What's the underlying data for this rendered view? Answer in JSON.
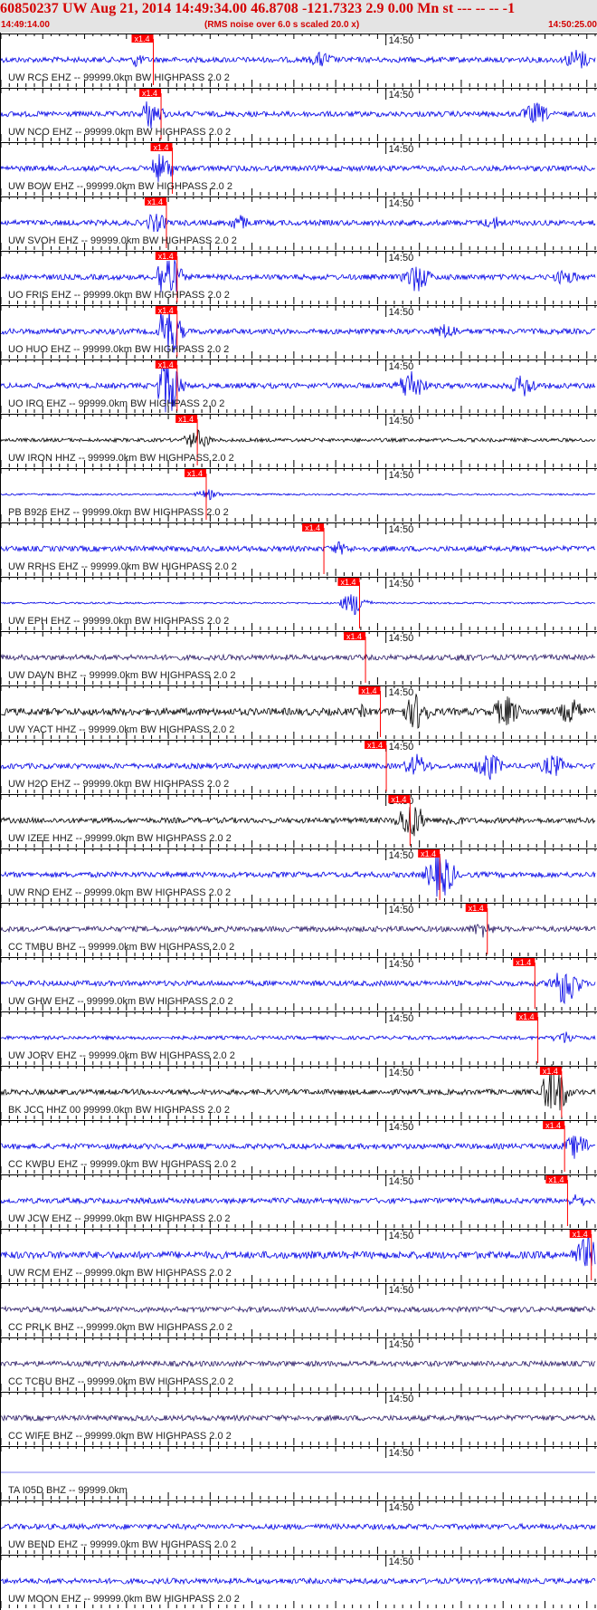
{
  "header": {
    "title": "60850237 UW Aug 21, 2014 14:49:34.00   46.8708 -121.7323  2.9 0.00 Mn st --- -- --  -1",
    "start_time": "14:49:14.00",
    "note": "(RMS noise over 6.0 s scaled 20.0 x)",
    "end_time": "14:50:25.00"
  },
  "time_tick_label": "14:50",
  "pick_label": "x1.4",
  "colors": {
    "header_bg": "#e4e4e4",
    "header_text": "#d40000",
    "blue": "#0000e6",
    "black": "#000000",
    "purple": "#2a1a66",
    "pick": "#ff0000",
    "axis": "#000000"
  },
  "stations": [
    {
      "label": "UW RCS EHZ -- 99999.0km BW  HIGHPASS  2.0  2",
      "color": "blue",
      "pick": 0.223,
      "amp": 3,
      "env": [
        [
          0.09,
          14
        ],
        [
          0.21,
          22
        ],
        [
          0.54,
          10
        ],
        [
          0.97,
          14
        ]
      ]
    },
    {
      "label": "UW NCO EHZ -- 99999.0km BW  HIGHPASS  2.0  2",
      "color": "blue",
      "pick": 0.236,
      "amp": 3,
      "env": [
        [
          0.25,
          18
        ],
        [
          0.9,
          14
        ]
      ]
    },
    {
      "label": "UW BOW EHZ -- 99999.0km BW  HIGHPASS  2.0  2",
      "color": "blue",
      "pick": 0.255,
      "amp": 3,
      "env": [
        [
          0.25,
          25
        ],
        [
          0.27,
          18
        ]
      ]
    },
    {
      "label": "UW SVOH EHZ -- 99999.0km BW  HIGHPASS  2.0  2",
      "color": "blue",
      "pick": 0.245,
      "amp": 3,
      "env": [
        [
          0.26,
          12
        ],
        [
          0.4,
          10
        ],
        [
          0.83,
          8
        ]
      ]
    },
    {
      "label": "UO FRIS EHZ -- 99999.0km BW  HIGHPASS  2.0  2",
      "color": "blue",
      "pick": 0.263,
      "amp": 3,
      "env": [
        [
          0.28,
          30
        ],
        [
          0.7,
          18
        ],
        [
          0.95,
          10
        ]
      ]
    },
    {
      "label": "UO HUO EHZ -- 99999.0km BW  HIGHPASS  2.0  2",
      "color": "blue",
      "pick": 0.263,
      "amp": 3,
      "env": [
        [
          0.28,
          34
        ],
        [
          0.75,
          10
        ]
      ]
    },
    {
      "label": "UO IRO EHZ -- 99999.0km BW  HIGHPASS  2.0  2",
      "color": "blue",
      "pick": 0.263,
      "amp": 3,
      "env": [
        [
          0.28,
          36
        ],
        [
          0.69,
          20
        ],
        [
          0.88,
          14
        ]
      ]
    },
    {
      "label": "UW IRON HHZ -- 99999.0km BW  HIGHPASS  2.0  2",
      "color": "black",
      "pick": 0.297,
      "amp": 2,
      "env": [
        [
          0.33,
          12
        ]
      ]
    },
    {
      "label": "PB B926 EHZ -- 99999.0km BW  HIGHPASS  2.0  2",
      "color": "blue",
      "pick": 0.312,
      "amp": 1,
      "env": [
        [
          0.02,
          14
        ],
        [
          0.35,
          6
        ]
      ]
    },
    {
      "label": "UW RRHS EHZ -- 99999.0km BW  HIGHPASS  2.0  2",
      "color": "blue",
      "pick": 0.51,
      "amp": 3,
      "env": [
        [
          0.15,
          12
        ],
        [
          0.57,
          8
        ]
      ]
    },
    {
      "label": "UW EPH EHZ -- 99999.0km BW  HIGHPASS  2.0  2",
      "color": "blue",
      "pick": 0.57,
      "amp": 1,
      "env": [
        [
          0.03,
          16
        ],
        [
          0.595,
          14
        ]
      ]
    },
    {
      "label": "UW DAVN BHZ -- 99999.0km BW  HIGHPASS  2.0  2",
      "color": "purple",
      "pick": 0.58,
      "amp": 3,
      "env": [
        [
          0.78,
          6
        ]
      ]
    },
    {
      "label": "UW YACT HHZ -- 99999.0km BW  HIGHPASS  2.0  2",
      "color": "black",
      "pick": 0.605,
      "amp": 4,
      "env": [
        [
          0.59,
          16
        ],
        [
          0.7,
          22
        ],
        [
          0.85,
          20
        ],
        [
          0.96,
          16
        ]
      ]
    },
    {
      "label": "UW H2O EHZ -- 99999.0km BW  HIGHPASS  2.0  2",
      "color": "blue",
      "pick": 0.615,
      "amp": 3,
      "env": [
        [
          0.7,
          14
        ],
        [
          0.82,
          18
        ],
        [
          0.93,
          14
        ]
      ]
    },
    {
      "label": "UW IZEE HHZ -- 99999.0km BW  HIGHPASS  2.0  2",
      "color": "black",
      "pick": 0.655,
      "amp": 3,
      "env": [
        [
          0.69,
          24
        ],
        [
          0.76,
          8
        ]
      ]
    },
    {
      "label": "UW RNO EHZ -- 99999.0km BW  HIGHPASS  2.0  2",
      "color": "blue",
      "pick": 0.705,
      "amp": 3,
      "env": [
        [
          0.74,
          30
        ]
      ]
    },
    {
      "label": "CC TMBU BHZ -- 99999.0km BW  HIGHPASS  2.0  2",
      "color": "purple",
      "pick": 0.785,
      "amp": 3,
      "env": [
        [
          0.81,
          10
        ]
      ]
    },
    {
      "label": "UW GHW EHZ -- 99999.0km BW  HIGHPASS  2.0  2",
      "color": "blue",
      "pick": 0.865,
      "amp": 3,
      "env": [
        [
          0.95,
          28
        ]
      ]
    },
    {
      "label": "UW JORV EHZ -- 99999.0km BW  HIGHPASS  2.0  2",
      "color": "blue",
      "pick": 0.87,
      "amp": 2,
      "env": [
        [
          0.95,
          8
        ]
      ]
    },
    {
      "label": "BK JCC HHZ 00 99999.0km BW  HIGHPASS  2.0  2",
      "color": "black",
      "pick": 0.91,
      "amp": 3,
      "env": [
        [
          0.69,
          20
        ],
        [
          0.82,
          16
        ],
        [
          0.93,
          34
        ]
      ]
    },
    {
      "label": "CC KWBU EHZ -- 99999.0km BW  HIGHPASS  2.0  2",
      "color": "blue",
      "pick": 0.915,
      "amp": 3,
      "env": [
        [
          0.97,
          16
        ]
      ]
    },
    {
      "label": "UW JCW EHZ -- 99999.0km BW  HIGHPASS  2.0  2",
      "color": "blue",
      "pick": 0.92,
      "amp": 3,
      "env": [
        [
          0.97,
          8
        ]
      ]
    },
    {
      "label": "UW RCM EHZ -- 99999.0km BW  HIGHPASS  2.0  2",
      "color": "blue",
      "pick": 0.96,
      "amp": 4,
      "env": [
        [
          0.985,
          22
        ]
      ]
    },
    {
      "label": "CC PRLK BHZ -- 99999.0km BW  HIGHPASS  2.0  2",
      "color": "purple",
      "pick": null,
      "amp": 3,
      "env": []
    },
    {
      "label": "CC TCBU BHZ -- 99999.0km BW  HIGHPASS  2.0  2",
      "color": "purple",
      "pick": null,
      "amp": 3,
      "env": []
    },
    {
      "label": "CC WIFE BHZ -- 99999.0km BW  HIGHPASS  2.0  2",
      "color": "purple",
      "pick": null,
      "amp": 3,
      "env": []
    },
    {
      "label": "TA I05D BHZ -- 99999.0km",
      "color": "blue",
      "pick": null,
      "amp": 0,
      "env": []
    },
    {
      "label": "UW BEND EHZ -- 99999.0km BW  HIGHPASS  2.0  2",
      "color": "blue",
      "pick": null,
      "amp": 3,
      "env": []
    },
    {
      "label": "UW MOON EHZ -- 99999.0km BW  HIGHPASS  2.0  2",
      "color": "blue",
      "pick": null,
      "amp": 3,
      "env": []
    }
  ]
}
